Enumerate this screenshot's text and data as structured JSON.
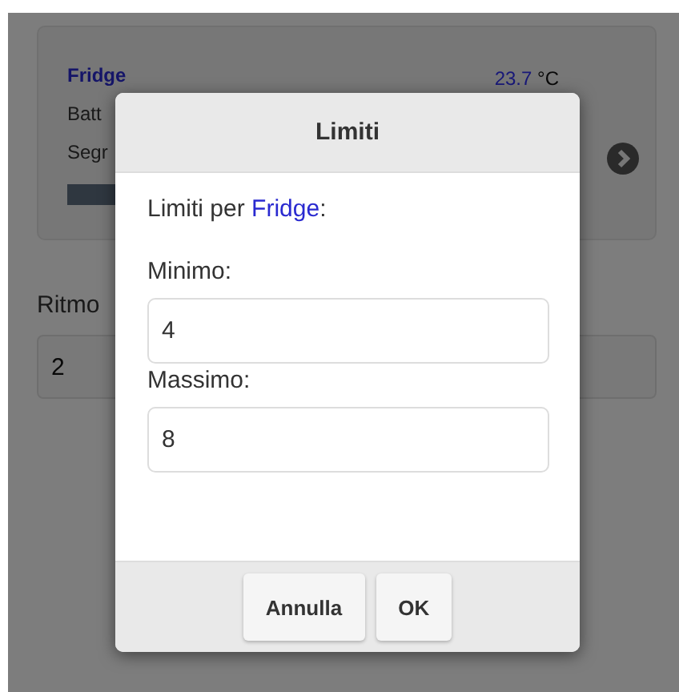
{
  "background": {
    "device_card": {
      "name": "Fridge",
      "temperature": "23.7",
      "unit": "°C",
      "line_1": "Batt",
      "line_2": "Segr"
    },
    "rate": {
      "label": "Ritmo",
      "value": "2"
    }
  },
  "dialog": {
    "title": "Limiti",
    "intro": "Limiti per ",
    "device": "Fridge",
    "intro_end": ":",
    "fields": [
      {
        "label": "Minimo:",
        "value": "4"
      },
      {
        "label": "Massimo:",
        "value": "8"
      }
    ],
    "buttons": [
      "Annulla",
      "OK"
    ]
  }
}
